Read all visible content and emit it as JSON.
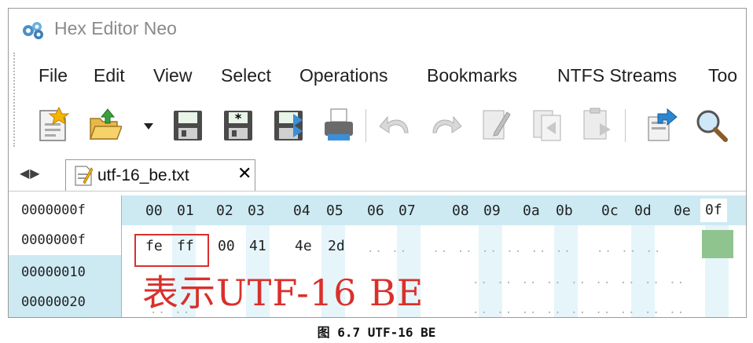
{
  "window": {
    "title": "Hex Editor Neo"
  },
  "menu": [
    "File",
    "Edit",
    "View",
    "Select",
    "Operations",
    "Bookmarks",
    "NTFS Streams",
    "Too"
  ],
  "toolbar": [
    "new-file-icon",
    "open-folder-icon",
    "dropdown-arrow-icon",
    "save-icon",
    "save-all-icon",
    "save-as-icon",
    "print-icon",
    "undo-icon",
    "redo-icon",
    "edit-icon",
    "copy-icon",
    "paste-icon",
    "export-icon",
    "search-icon"
  ],
  "tabs": {
    "arrows": "◀▶",
    "active": {
      "label": "utf-16_be.txt",
      "close": "✕"
    }
  },
  "hex": {
    "header_offset": "0000000f",
    "columns": [
      "00",
      "01",
      "02",
      "03",
      "04",
      "05",
      "06",
      "07",
      "08",
      "09",
      "0a",
      "0b",
      "0c",
      "0d",
      "0e",
      "0f"
    ],
    "rows": [
      {
        "offset": "0000000f",
        "bytes": [
          "fe",
          "ff",
          "00",
          "41",
          "4e",
          "2d"
        ]
      },
      {
        "offset": "00000010",
        "bytes": []
      },
      {
        "offset": "00000020",
        "bytes": []
      }
    ]
  },
  "annotation": "表示UTF-16 BE",
  "caption": "图 6.7 UTF-16 BE",
  "colors": {
    "accent": "#d9302c",
    "header_bg": "#cdeaf3",
    "selection": "#8fc48f"
  }
}
